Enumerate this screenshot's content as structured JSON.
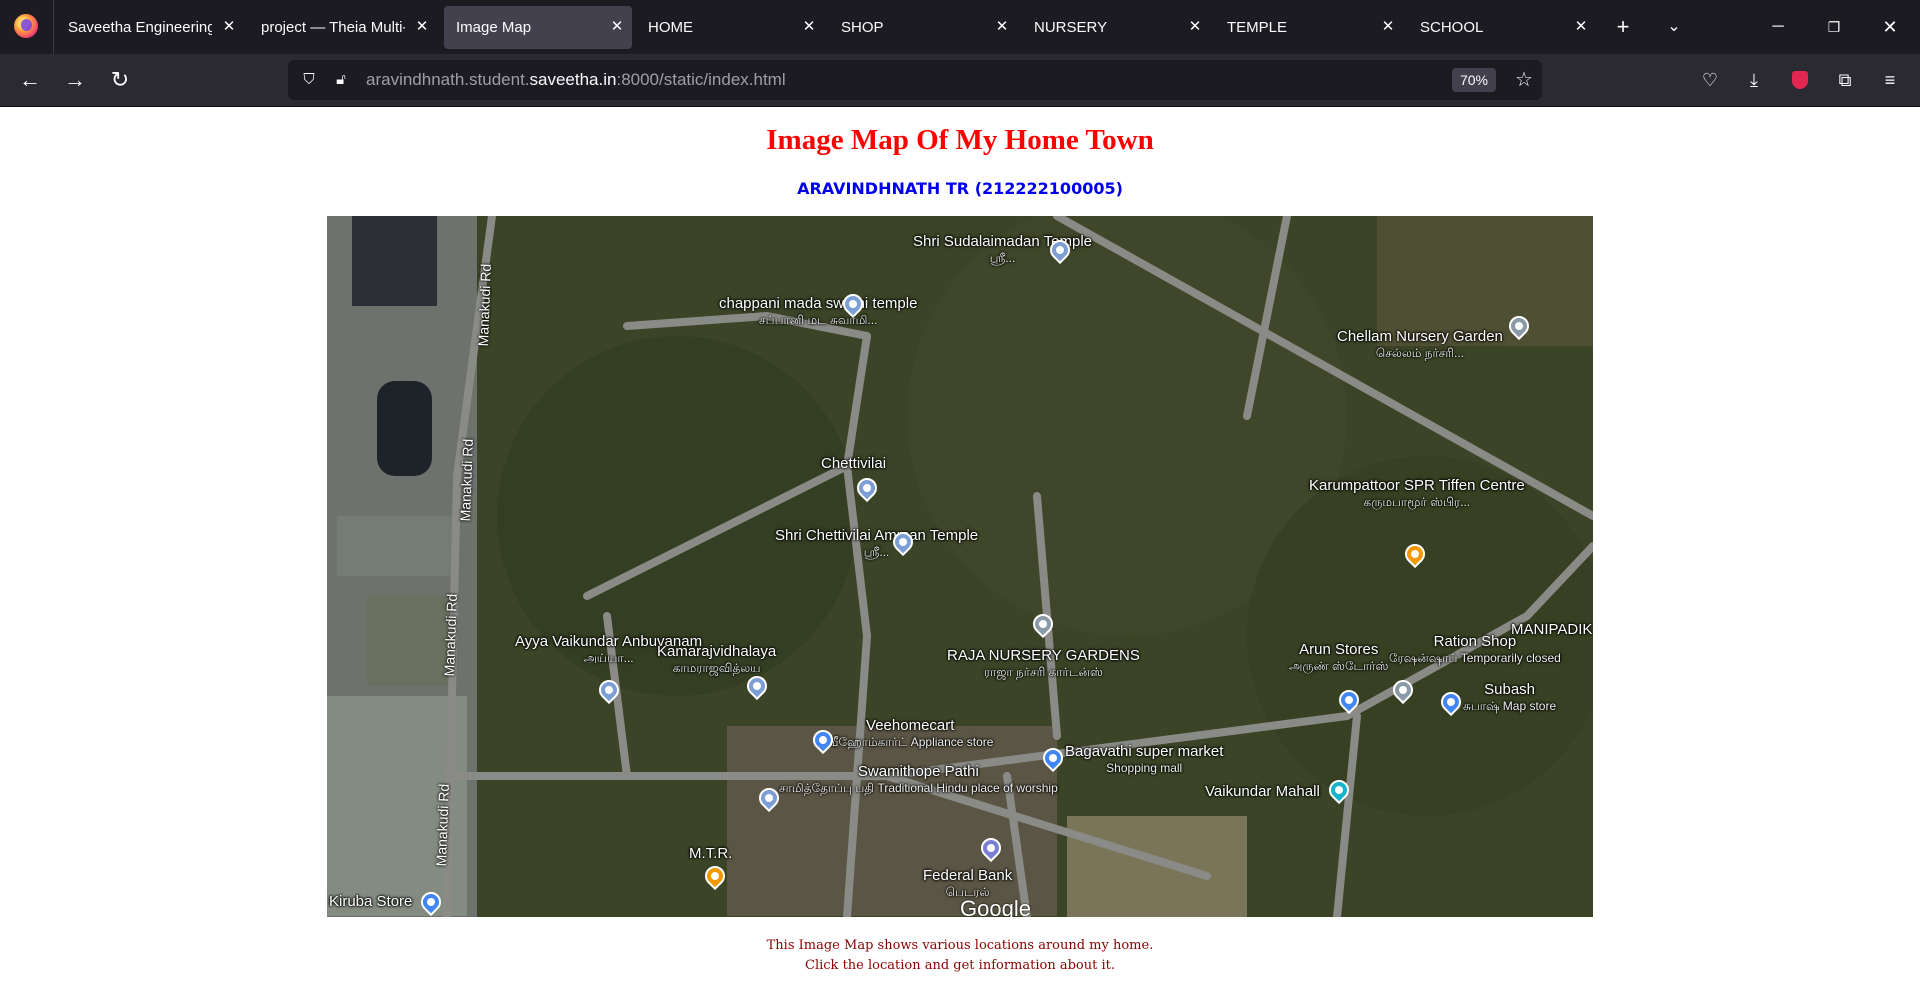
{
  "browser": {
    "tabs": [
      {
        "title": "Saveetha Engineering",
        "active": false
      },
      {
        "title": "project — Theia Multi-",
        "active": false
      },
      {
        "title": "Image Map",
        "active": true
      },
      {
        "title": "HOME",
        "active": false
      },
      {
        "title": "SHOP",
        "active": false
      },
      {
        "title": "NURSERY",
        "active": false
      },
      {
        "title": "TEMPLE",
        "active": false
      },
      {
        "title": "SCHOOL",
        "active": false
      }
    ],
    "url_prefix": "aravindhnath.student.",
    "url_domain": "saveetha.in",
    "url_suffix": ":8000/static/index.html",
    "zoom": "70%"
  },
  "page": {
    "title": "Image Map Of My Home Town",
    "subtitle": "ARAVINDHNATH TR (212222100005)",
    "caption_line1": "This Image Map shows various locations around my home.",
    "caption_line2": "Click the location and get information about it."
  },
  "map": {
    "roads": [
      "Manakudi Rd",
      "Manakudi Rd",
      "Manakudi Rd",
      "Manakudi Rd"
    ],
    "places": [
      {
        "name": "Shri Sudalaimadan Temple",
        "sub": "ஸ்ரீ...",
        "pin_color": "#7b9fd4"
      },
      {
        "name": "chappani mada swami temple",
        "sub": "சப்பானி மட சுவாமி...",
        "pin_color": "#7b9fd4"
      },
      {
        "name": "Chellam Nursery Garden",
        "sub": "செல்லம் நர்சரி...",
        "pin_color": "#8a9aa6"
      },
      {
        "name": "Chettivilai",
        "sub": "",
        "pin_color": "#7b9fd4"
      },
      {
        "name": "Shri Chettivilai Amman Temple",
        "sub": "ஸ்ரீ...",
        "pin_color": "#7b9fd4"
      },
      {
        "name": "Karumpattoor SPR Tiffen Centre",
        "sub": "கருமபாமூர் ஸ்பிர...",
        "pin_color": "#f29900"
      },
      {
        "name": "RAJA NURSERY GARDENS",
        "sub": "ராஜா நர்சரி கார்டன்ஸ்",
        "pin_color": "#8a9aa6"
      },
      {
        "name": "Ayya Vaikundar Anbuvanam",
        "sub": "அய்யா...",
        "pin_color": "#7b9fd4"
      },
      {
        "name": "Kamarajvidhalaya",
        "sub": "காமராஜவித்லய",
        "pin_color": "#7b9fd4"
      },
      {
        "name": "Arun Stores",
        "sub": "அருண் ஸ்டோர்ஸ்",
        "pin_color": "#4285f4"
      },
      {
        "name": "Ration Shop",
        "sub": "ரேஷன்ஷாப் Temporarily closed",
        "pin_color": "#8a9aa6"
      },
      {
        "name": "MANIPADIK",
        "sub": "",
        "pin_color": ""
      },
      {
        "name": "Subash",
        "sub": "சுபாஷ் Map store",
        "pin_color": "#4285f4"
      },
      {
        "name": "Veehomecart",
        "sub": "வீஹோம்கார்ட் Appliance store",
        "pin_color": "#4285f4"
      },
      {
        "name": "Bagavathi super market",
        "sub": "Shopping mall",
        "pin_color": "#4285f4"
      },
      {
        "name": "Swamithope Pathi",
        "sub": "சாமித்தோப்பு பதி Traditional Hindu place of worship",
        "pin_color": "#7b9fd4"
      },
      {
        "name": "Vaikundar Mahall",
        "sub": "",
        "pin_color": "#12b5cb"
      },
      {
        "name": "M.T.R.",
        "sub": "",
        "pin_color": "#f29900"
      },
      {
        "name": "Federal Bank",
        "sub": "பெடரல்",
        "pin_color": "#7b7fd4"
      },
      {
        "name": "Kiruba Store",
        "sub": "",
        "pin_color": "#4285f4"
      }
    ],
    "watermark": "Google"
  }
}
